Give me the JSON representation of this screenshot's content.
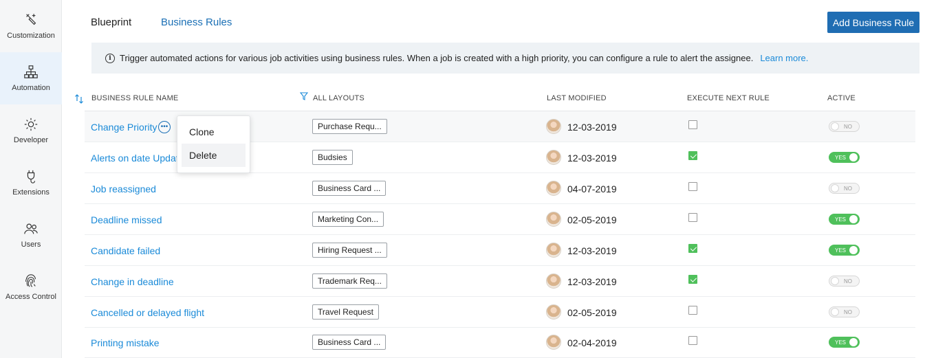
{
  "sidebar": {
    "items": [
      {
        "label": "Customization",
        "icon": "customization-icon"
      },
      {
        "label": "Automation",
        "icon": "automation-icon",
        "active": true
      },
      {
        "label": "Developer",
        "icon": "developer-icon"
      },
      {
        "label": "Extensions",
        "icon": "extensions-icon"
      },
      {
        "label": "Users",
        "icon": "users-icon"
      },
      {
        "label": "Access Control",
        "icon": "fingerprint-icon"
      }
    ]
  },
  "header": {
    "tabs": [
      {
        "label": "Blueprint"
      },
      {
        "label": "Business Rules",
        "active": true
      }
    ],
    "add_button": "Add Business Rule"
  },
  "banner": {
    "icon": "info-icon",
    "text": "Trigger automated actions for various job activities using business rules. When a job is created with a high priority, you can configure a rule to alert the assignee.",
    "link": "Learn more."
  },
  "table": {
    "columns": {
      "name": "BUSINESS RULE NAME",
      "layouts": "ALL LAYOUTS",
      "modified": "LAST MODIFIED",
      "execute": "EXECUTE NEXT RULE",
      "active": "ACTIVE"
    },
    "rows": [
      {
        "name": "Change Priority",
        "layout": "Purchase Requ...",
        "date": "12-03-2019",
        "execute_next": false,
        "active": false,
        "toggle": "NO"
      },
      {
        "name": "Alerts on date Updat",
        "layout": "Budsies",
        "date": "12-03-2019",
        "execute_next": true,
        "active": true,
        "toggle": "YES"
      },
      {
        "name": "Job reassigned",
        "layout": "Business Card ...",
        "date": "04-07-2019",
        "execute_next": false,
        "active": false,
        "toggle": "NO"
      },
      {
        "name": "Deadline missed",
        "layout": "Marketing Con...",
        "date": "02-05-2019",
        "execute_next": false,
        "active": true,
        "toggle": "YES"
      },
      {
        "name": "Candidate failed",
        "layout": "Hiring Request ...",
        "date": "12-03-2019",
        "execute_next": true,
        "active": true,
        "toggle": "YES"
      },
      {
        "name": "Change in deadline",
        "layout": "Trademark Req...",
        "date": "12-03-2019",
        "execute_next": true,
        "active": false,
        "toggle": "NO"
      },
      {
        "name": "Cancelled or delayed flight",
        "layout": "Travel Request",
        "date": "02-05-2019",
        "execute_next": false,
        "active": false,
        "toggle": "NO"
      },
      {
        "name": "Printing mistake",
        "layout": "Business Card ...",
        "date": "02-04-2019",
        "execute_next": false,
        "active": true,
        "toggle": "YES"
      }
    ]
  },
  "context_menu": {
    "items": [
      {
        "label": "Clone"
      },
      {
        "label": "Delete",
        "hovered": true
      }
    ]
  },
  "colors": {
    "accent": "#1f6db3",
    "link": "#1a8ad8",
    "toggle_on": "#4fc05b"
  }
}
